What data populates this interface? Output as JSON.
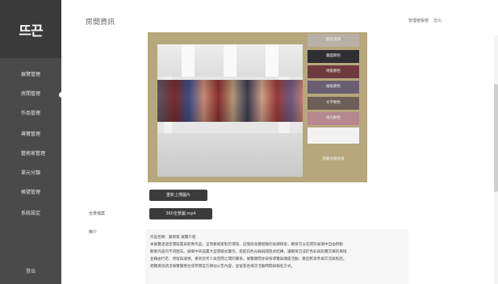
{
  "sidebar": {
    "logo": "뜨끈",
    "items": [
      {
        "label": "展覽管理"
      },
      {
        "label": "房間管理"
      },
      {
        "label": "作品管理"
      },
      {
        "label": "導覽管理"
      },
      {
        "label": "藝術家管理"
      },
      {
        "label": "單元分類"
      },
      {
        "label": "帳號管理"
      },
      {
        "label": "系統設定"
      }
    ],
    "active_index": 1,
    "footer": "登出"
  },
  "header": {
    "title": "房間資訊",
    "user": "管理者帳號",
    "logout": "登出"
  },
  "preview": {
    "swatches": [
      {
        "label": "顏色選擇",
        "color": "#b9b1a7"
      },
      {
        "label": "牆面顏色",
        "color": "#2e2e33"
      },
      {
        "label": "地板顏色",
        "color": "#6f3a3e"
      },
      {
        "label": "展板顏色",
        "color": "#6b5e73"
      },
      {
        "label": "文字顏色",
        "color": "#6d5e58"
      },
      {
        "label": "燈光顏色",
        "color": "#b58790"
      },
      {
        "label": "",
        "color": "#f2f2f2"
      }
    ],
    "note": "預覽房間效果"
  },
  "actions": {
    "upload_label": "重新上傳圖片",
    "file_field_label": "全景檔案",
    "file_name": "360全景圖.mp4",
    "description_label": "簡介"
  },
  "description": {
    "heading": "作品名稱：藝術家 展覽介紹",
    "lines": [
      "本展覽透過空間裝置與影像作品，呈現藝術家對於環境、記憶與身體經驗的長期探索，觀眾可以在環形展場中自由移動",
      "觀看作品的不同面向。展場中央設置大型環繞式畫作，搭配白色光線與開放式結構，讓觀眾沉浸於色彩與形體交織的場域",
      "並藉由行走、停留與凝視，重新思考人與空間之間的關係。展覽期間亦安排導覽與講座活動，歡迎民眾參與交流與對話。",
      "相關資訊請洽展覽服務台或參閱官方網站公告內容，並留意各場次活動時間與報名方式。"
    ]
  }
}
